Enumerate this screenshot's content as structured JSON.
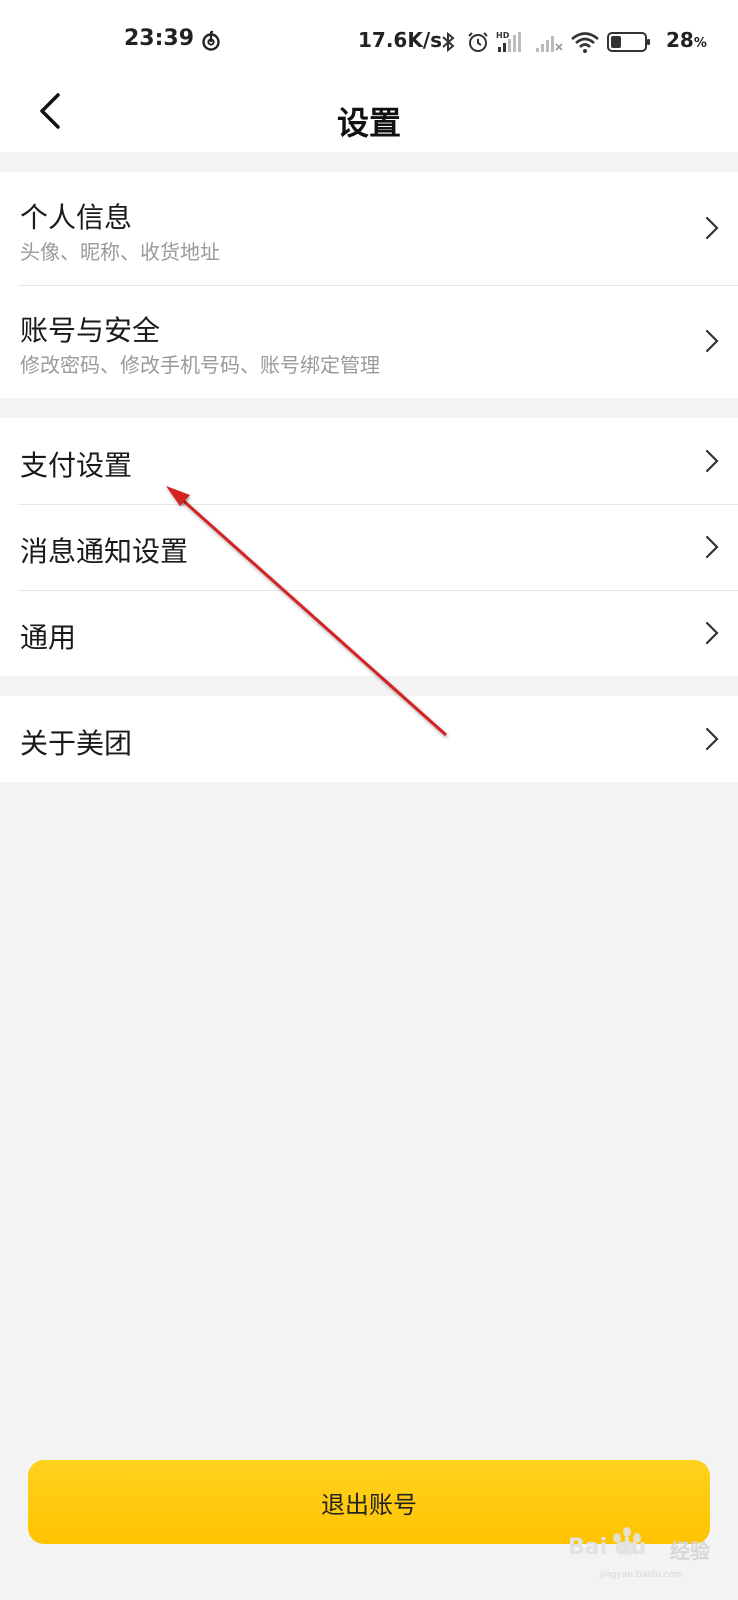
{
  "status_bar": {
    "time": "23:39",
    "net_speed": "17.6K/s",
    "battery": "28",
    "battery_unit": "%",
    "hd_label": "HD",
    "icons": [
      "netease-music-icon",
      "bluetooth-icon",
      "alarm-icon",
      "signal-hd-icon",
      "signal-no-service-icon",
      "wifi-icon",
      "battery-icon"
    ]
  },
  "nav": {
    "title": "设置",
    "back_icon": "chevron-left-icon"
  },
  "groups": [
    {
      "items": [
        {
          "label": "个人信息",
          "sub": "头像、昵称、收货地址"
        },
        {
          "label": "账号与安全",
          "sub": "修改密码、修改手机号码、账号绑定管理"
        }
      ]
    },
    {
      "items": [
        {
          "label": "支付设置"
        },
        {
          "label": "消息通知设置"
        },
        {
          "label": "通用"
        }
      ]
    },
    {
      "items": [
        {
          "label": "关于美团"
        }
      ]
    }
  ],
  "logout_label": "退出账号",
  "watermark": {
    "brand": "Bai du",
    "text": "经验",
    "url": "jingyan.baidu.com"
  },
  "colors": {
    "accent": "#ffc300",
    "annotation": "#d42020",
    "background": "#f3f3f3"
  }
}
